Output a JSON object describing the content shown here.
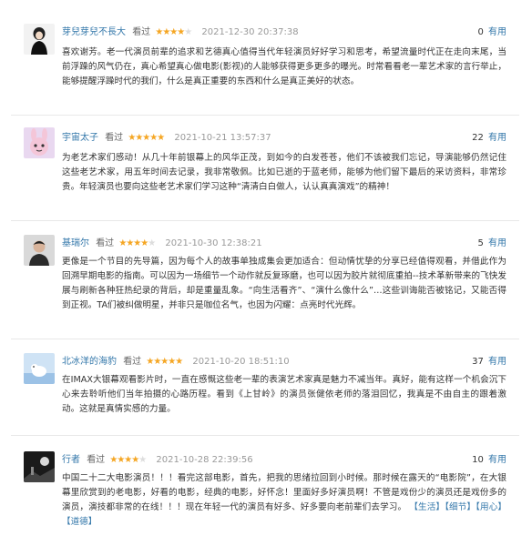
{
  "reviews": [
    {
      "user": "芽兒芽兒不長大",
      "watched": "看过",
      "stars": 4,
      "time": "2021-12-30 20:37:38",
      "useful_count": "0",
      "useful_label": "有用",
      "text": "喜欢谢芳。老一代演员前辈的追求和艺德真心值得当代年轻演员好好学习和思考，希望流量时代正在走向末尾，当前浮躁的风气仍在，真心希望真心做电影(影视)的人能够获得更多更多的曝光。时常看看老一辈艺术家的言行举止，能够提醒浮躁时代的我们，什么是真正重要的东西和什么是真正美好的状态。"
    },
    {
      "user": "宇宙太子",
      "watched": "看过",
      "stars": 5,
      "time": "2021-10-21 13:57:37",
      "useful_count": "22",
      "useful_label": "有用",
      "text": "为老艺术家们感动！从几十年前银幕上的风华正茂，到如今的白发苍苍，他们不该被我们忘记，导演能够仍然记住这些老艺术家，用五年时间去记录，我非常敬佩。比如已逝的于蓝老师，能够为他们留下最后的采访资料，非常珍贵。年轻演员也要向这些老艺术家们学习这种“清清白白做人，认认真真演戏”的精神！"
    },
    {
      "user": "基瑞尔",
      "watched": "看过",
      "stars": 4,
      "time": "2021-10-30 12:38:21",
      "useful_count": "5",
      "useful_label": "有用",
      "text": "更像是一个节目的先导篇，因为每个人的故事单独成集会更加适合：但动情忧挚的分享已经值得观看，并借此作为回溯早期电影的指南。可以因为一场细节一个动作就反复琢磨，也可以因为胶片就彻底重拍--技术革新带来的飞快发展与刷新各种狂热纪录的背后，却是重量乱象。“向生活看齐”、“演什么像什么”…这些训诲能否被铭记，又能否得到正视。TA们被纠做明星，并非只是咖位名气，也因为闪耀：点亮时代光辉。"
    },
    {
      "user": "北冰洋的海豹",
      "watched": "看过",
      "stars": 5,
      "time": "2021-10-20 18:51:10",
      "useful_count": "37",
      "useful_label": "有用",
      "text": "在IMAX大银幕观看影片时，一直在感慨这些老一辈的表演艺术家真是魅力不减当年。真好，能有这样一个机会沉下心来去聆听他们当年拍摄的心路历程。看到《上甘岭》的演员张健依老师的落泪回忆，我真是不由自主的跟着激动。这就是真情实感的力量。"
    },
    {
      "user": "行者",
      "watched": "看过",
      "stars": 4,
      "time": "2021-10-28 22:39:56",
      "useful_count": "10",
      "useful_label": "有用",
      "text": "中国二十二大电影演员！！！看完这部电影，首先，把我的思绪拉回到小时候。那时候在露天的“电影院”，在大银幕里欣赏到的老电影，好看的电影，经典的电影，好怀念！里面好多好演员啊！不管是戏份少的演员还是戏份多的演员，演技都非常的在线！！！现在年轻一代的演员有好多、好多要向老前辈们去学习。",
      "tags": "【生活】【细节】【用心】【道德】"
    }
  ]
}
